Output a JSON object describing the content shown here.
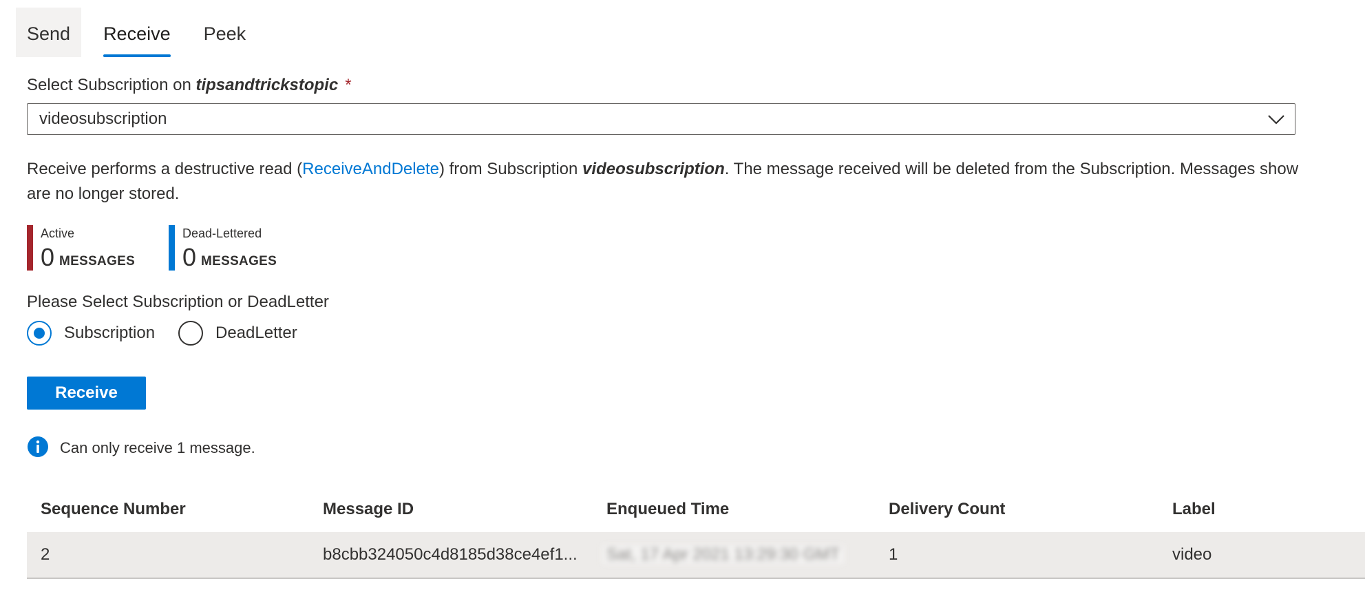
{
  "tabs": [
    {
      "label": "Send"
    },
    {
      "label": "Receive"
    },
    {
      "label": "Peek"
    }
  ],
  "subscription_select": {
    "label_prefix": "Select Subscription on ",
    "topic": "tipsandtrickstopic",
    "required_marker": "*",
    "value": "videosubscription"
  },
  "description": {
    "part1": "Receive performs a destructive read (",
    "link": "ReceiveAndDelete",
    "part2": ") from Subscription ",
    "subscription": "videosubscription",
    "part3": ". The message received will be deleted from the Subscription. Messages show",
    "line2": "are no longer stored."
  },
  "counters": [
    {
      "title": "Active",
      "count": "0",
      "unit": "MESSAGES",
      "color": "#a4262c"
    },
    {
      "title": "Dead-Lettered",
      "count": "0",
      "unit": "MESSAGES",
      "color": "#0078d4"
    }
  ],
  "radio_group": {
    "label": "Please Select Subscription or DeadLetter",
    "options": [
      {
        "label": "Subscription",
        "checked": true
      },
      {
        "label": "DeadLetter",
        "checked": false
      }
    ]
  },
  "receive_button": {
    "label": "Receive"
  },
  "info": {
    "text": "Can only receive 1 message.",
    "icon": "info-icon"
  },
  "table": {
    "columns": [
      "Sequence Number",
      "Message ID",
      "Enqueued Time",
      "Delivery Count",
      "Label"
    ],
    "rows": [
      {
        "sequence_number": "2",
        "message_id": "b8cbb324050c4d8185d38ce4ef1...",
        "enqueued_time": "Sat, 17 Apr 2021 13:29:30 GMT",
        "delivery_count": "1",
        "label": "video"
      }
    ]
  },
  "colors": {
    "accent": "#0078d4",
    "active_bar": "#a4262c",
    "dead_lettered_bar": "#0078d4"
  }
}
